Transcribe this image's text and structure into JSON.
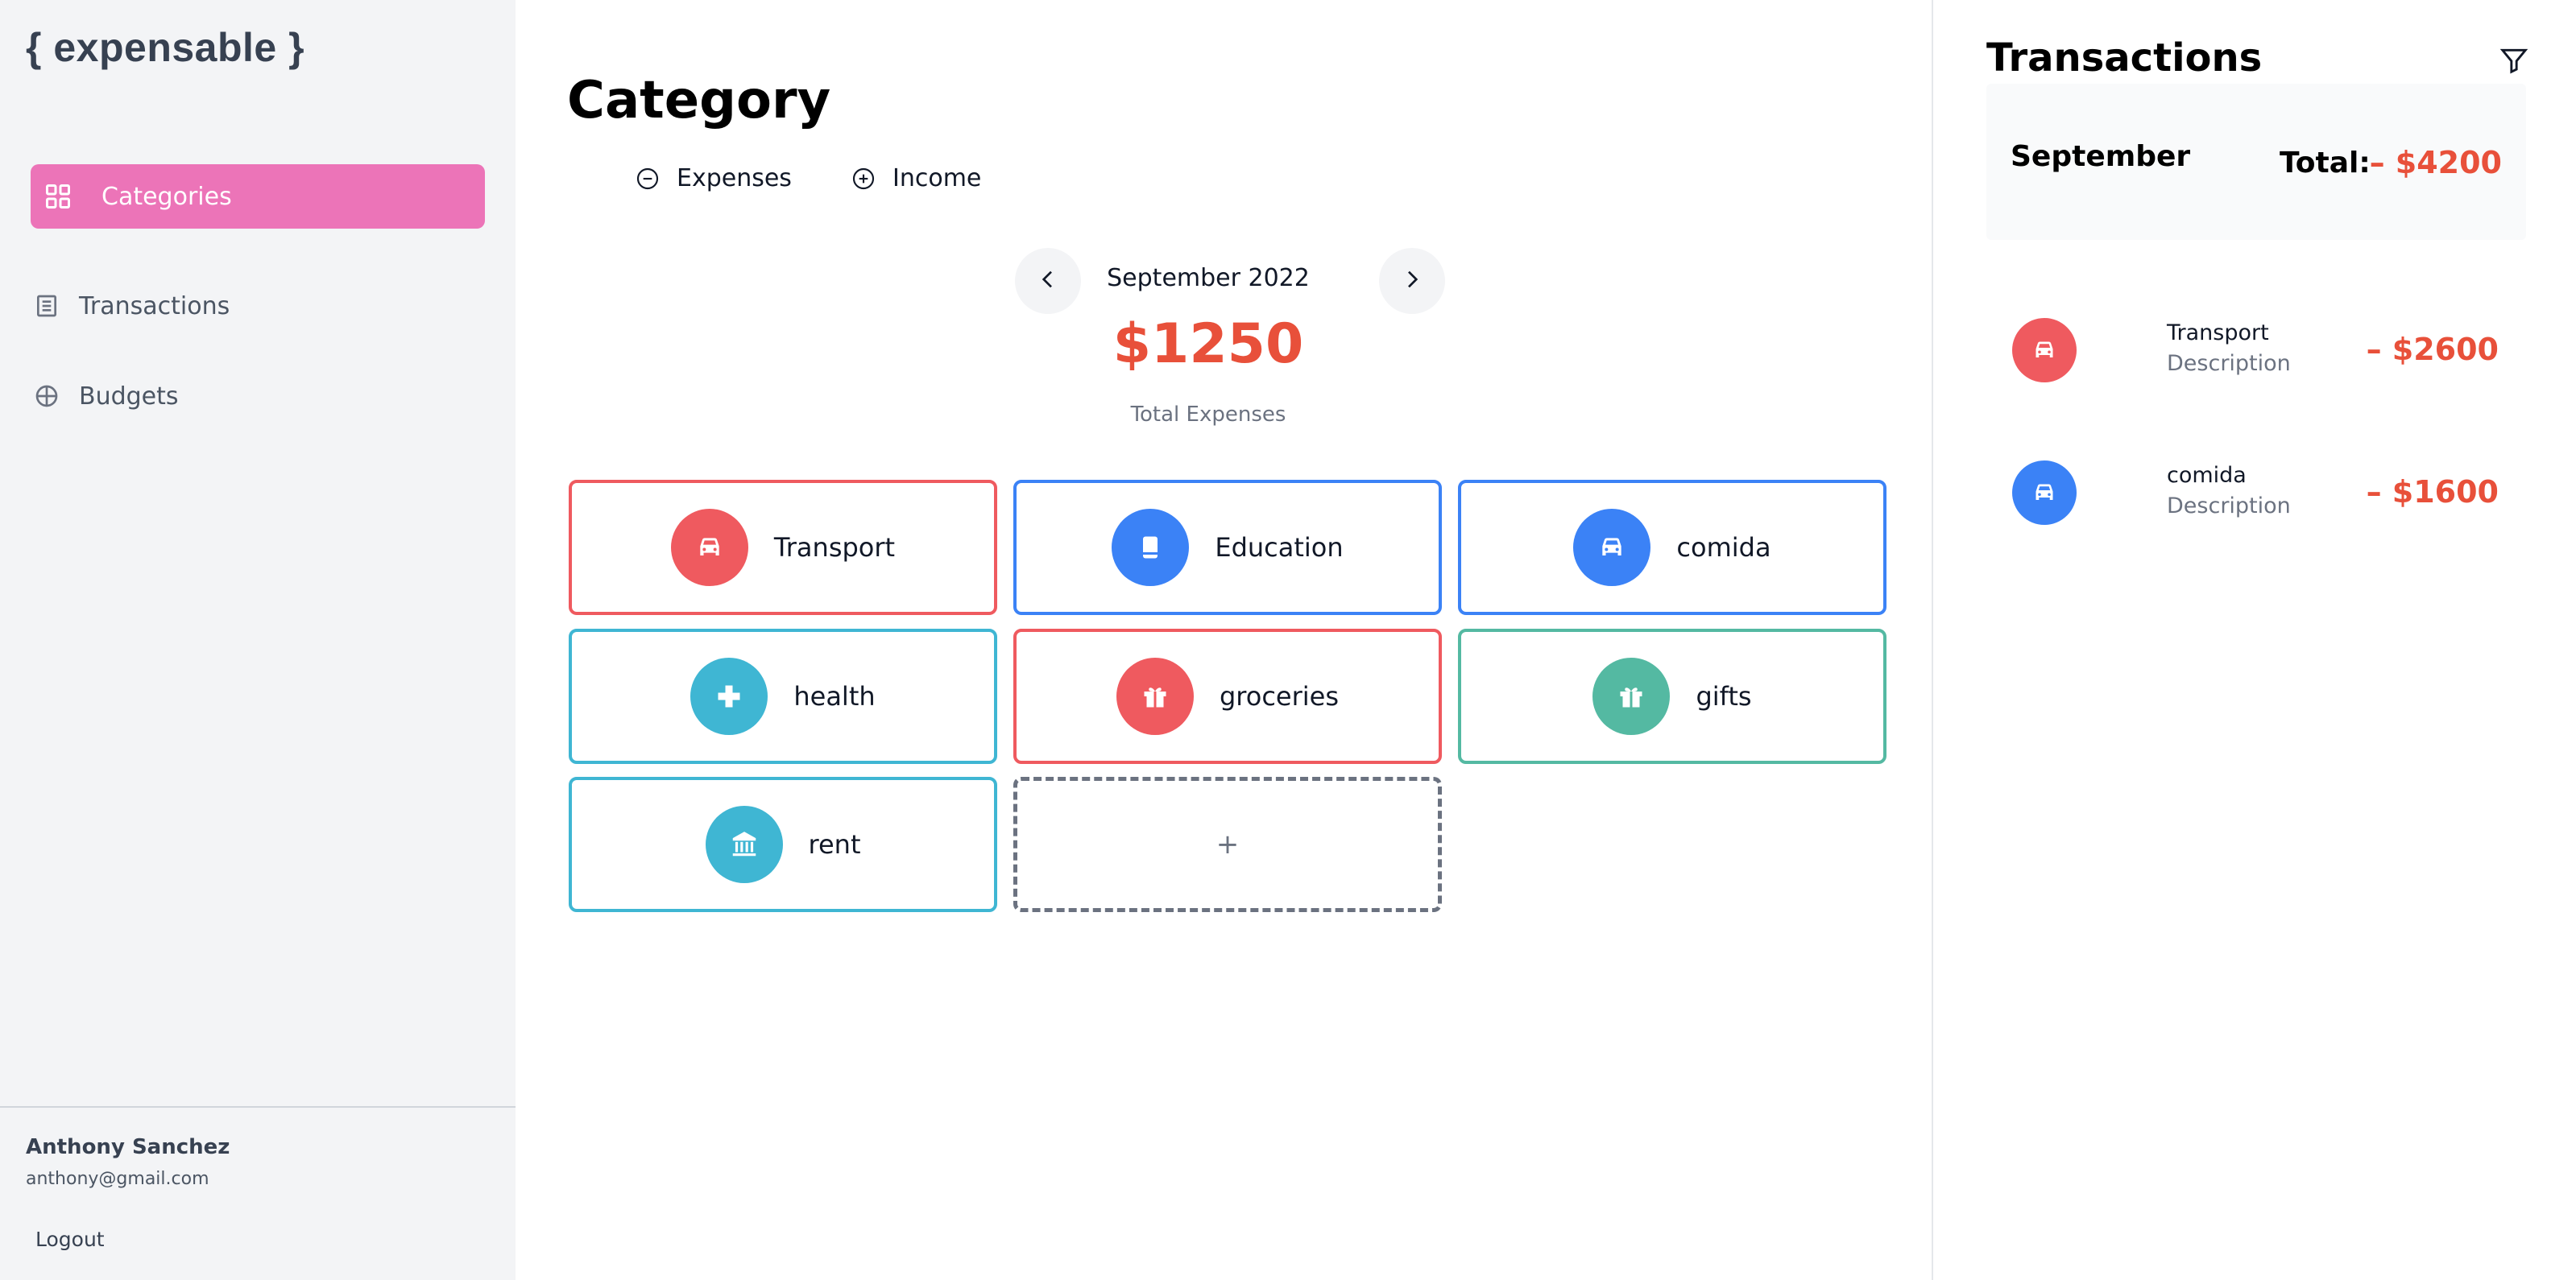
{
  "app": {
    "logo": "{ expensable }"
  },
  "sidebar": {
    "items": [
      {
        "label": "Categories",
        "icon": "grid-icon",
        "active": true
      },
      {
        "label": "Transactions",
        "icon": "list-icon",
        "active": false
      },
      {
        "label": "Budgets",
        "icon": "crosshair-icon",
        "active": false
      }
    ],
    "user": {
      "name": "Anthony Sanchez",
      "email": "anthony@gmail.com"
    },
    "logout_label": "Logout"
  },
  "main": {
    "title": "Category",
    "toggles": [
      {
        "label": "Expenses",
        "icon": "minus-circle-icon"
      },
      {
        "label": "Income",
        "icon": "plus-circle-icon"
      }
    ],
    "month": "September 2022",
    "total_amount": "$1250",
    "total_label": "Total Expenses",
    "categories": [
      {
        "label": "Transport",
        "icon": "car-icon",
        "color": "#ef5a5f"
      },
      {
        "label": "Education",
        "icon": "book-icon",
        "color": "#3b82f6"
      },
      {
        "label": "comida",
        "icon": "car-icon",
        "color": "#3b82f6"
      },
      {
        "label": "health",
        "icon": "medical-cross-icon",
        "color": "#3fb6d3"
      },
      {
        "label": "groceries",
        "icon": "gift-icon",
        "color": "#ef5a5f"
      },
      {
        "label": "gifts",
        "icon": "gift-icon",
        "color": "#54b9a2"
      },
      {
        "label": "rent",
        "icon": "bank-icon",
        "color": "#3fb6d3"
      }
    ],
    "add_label": "+"
  },
  "transactions": {
    "title": "Transactions",
    "summary": {
      "month": "September",
      "total_label": "Total:",
      "total": "– $4200"
    },
    "items": [
      {
        "name": "Transport",
        "description": "Description",
        "amount": "– $2600",
        "icon": "car-icon",
        "color": "#ef5a5f"
      },
      {
        "name": "comida",
        "description": "Description",
        "amount": "– $1600",
        "icon": "car-icon",
        "color": "#3b82f6"
      }
    ]
  },
  "colors": {
    "accent": "#ec74b8",
    "expense": "#e8503a"
  }
}
